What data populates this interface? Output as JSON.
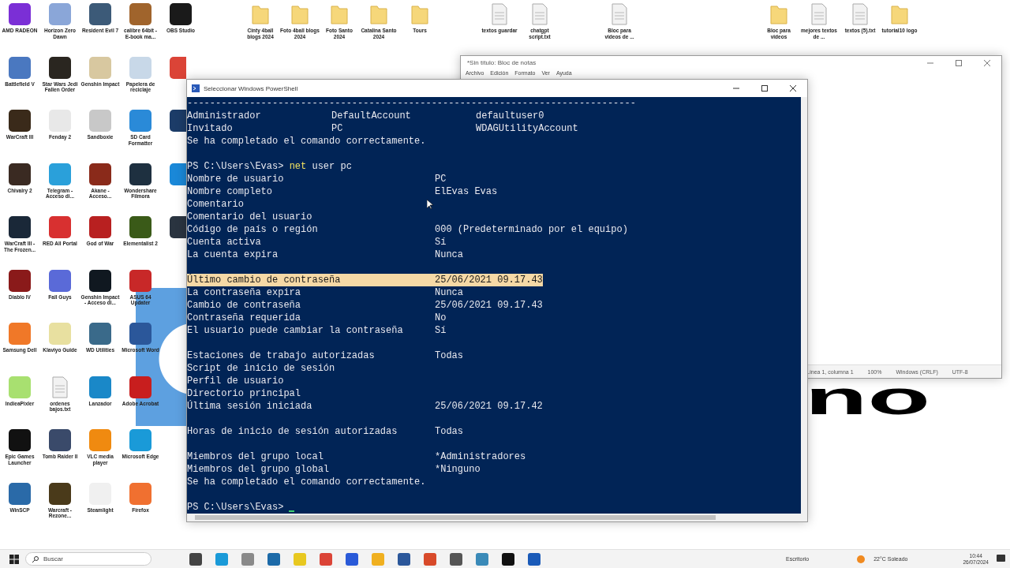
{
  "desktop": {
    "wallpaper_text": "no",
    "grid": [
      [
        {
          "label": "AMD RADEON",
          "kind": "app",
          "color": "#7b2fd6"
        },
        {
          "label": "Horizon Zero Dawn",
          "kind": "app",
          "color": "#8aa6d8"
        },
        {
          "label": "Resident Evil 7",
          "kind": "app",
          "color": "#3c5a78"
        },
        {
          "label": "calibre 64bit - E-book ma...",
          "kind": "app",
          "color": "#a0642c"
        },
        {
          "label": "OBS Studio",
          "kind": "app",
          "color": "#1a1a1a"
        }
      ],
      [
        {
          "label": "Battlefield V",
          "kind": "app",
          "color": "#4a78c0"
        },
        {
          "label": "Star Wars Jedi Fallen Order",
          "kind": "app",
          "color": "#2a2620"
        },
        {
          "label": "Genshin Impact",
          "kind": "app",
          "color": "#d8c8a0"
        },
        {
          "label": "Papelera de reciclaje",
          "kind": "app",
          "color": "#c8d8e8"
        },
        {
          "kind": "app",
          "color": "#db4437"
        }
      ],
      [
        {
          "label": "WarCraft III",
          "kind": "app",
          "color": "#3a2a1a"
        },
        {
          "label": "Fenday 2",
          "kind": "app",
          "color": "#e8e8e8"
        },
        {
          "label": "Sandboxie",
          "kind": "app",
          "color": "#c8c8c8"
        },
        {
          "label": "SD Card Formatter",
          "kind": "app",
          "color": "#2a8ad8"
        },
        {
          "kind": "app",
          "color": "#1c3c68"
        }
      ],
      [
        {
          "label": "Chivalry 2",
          "kind": "app",
          "color": "#3a2a22"
        },
        {
          "label": "Telegram - Acceso di...",
          "kind": "app",
          "color": "#2aa0da"
        },
        {
          "label": "Akane - Acceso...",
          "kind": "app",
          "color": "#8a2a1a"
        },
        {
          "label": "Wondershare Filmora",
          "kind": "app",
          "color": "#1e3040"
        },
        {
          "kind": "app",
          "color": "#1a88d8"
        }
      ],
      [
        {
          "label": "WarCraft III - The Frozen...",
          "kind": "app",
          "color": "#1a2838"
        },
        {
          "label": "RED All Portal",
          "kind": "app",
          "color": "#d83030"
        },
        {
          "label": "God of War",
          "kind": "app",
          "color": "#b82020"
        },
        {
          "label": "Elementalist 2",
          "kind": "app",
          "color": "#3a5a18"
        },
        {
          "kind": "app",
          "color": "#2a3440"
        }
      ],
      [
        {
          "label": "Diablo IV",
          "kind": "app",
          "color": "#8a1a1a"
        },
        {
          "label": "Fall Guys",
          "kind": "app",
          "color": "#5a6ad8"
        },
        {
          "label": "Genshin Impact - Acceso di...",
          "kind": "app",
          "color": "#101820"
        },
        {
          "label": "ASUS 64 Updater",
          "kind": "app",
          "color": "#c82828"
        }
      ],
      [
        {
          "label": "Samsung Dell",
          "kind": "app",
          "color": "#f07828"
        },
        {
          "label": "Klaviyo Guide",
          "kind": "app",
          "color": "#e8e0a0"
        },
        {
          "label": "WD Utilities",
          "kind": "app",
          "color": "#3a6a8a"
        },
        {
          "label": "Microsoft Word",
          "kind": "app",
          "color": "#2b579a"
        }
      ],
      [
        {
          "label": "IndieaPixler",
          "kind": "app",
          "color": "#a8e070"
        },
        {
          "label": "ordenes bajos.txt",
          "kind": "file"
        },
        {
          "label": "Lanzador",
          "kind": "app",
          "color": "#1a88c8"
        },
        {
          "label": "Adobe Acrobat",
          "kind": "app",
          "color": "#c81e1e"
        }
      ],
      [
        {
          "label": "Epic Games Launcher",
          "kind": "app",
          "color": "#111111"
        },
        {
          "label": "Tomb Raider II",
          "kind": "app",
          "color": "#3a4a6a"
        },
        {
          "label": "VLC media player",
          "kind": "app",
          "color": "#f08a10"
        },
        {
          "label": "Microsoft Edge",
          "kind": "app",
          "color": "#1a9ad8"
        }
      ],
      [
        {
          "label": "WinSCP",
          "kind": "app",
          "color": "#2a6aa8"
        },
        {
          "label": "Warcraft - Rezone...",
          "kind": "app",
          "color": "#4a3a1a"
        },
        {
          "label": "Steamlight",
          "kind": "app",
          "color": "#f0f0f0"
        },
        {
          "label": "Firefox",
          "kind": "app",
          "color": "#f07030"
        }
      ]
    ],
    "top_row": [
      {
        "label": "Cinty 4ball blogs 2024",
        "kind": "folder"
      },
      {
        "label": "Foto 4ball blogs 2024",
        "kind": "folder"
      },
      {
        "label": "Foto Santo 2024",
        "kind": "folder"
      },
      {
        "label": "Catalina Santo 2024",
        "kind": "folder"
      },
      {
        "label": "Tours",
        "kind": "folder"
      },
      {
        "label": "textos guardar",
        "kind": "file"
      },
      {
        "label": "chatgpt script.txt",
        "kind": "file"
      },
      {
        "label": "Bloc para videos de ...",
        "kind": "file"
      },
      {
        "label": "Bloc para videos",
        "kind": "folder"
      },
      {
        "label": "mejores textos de ...",
        "kind": "file"
      },
      {
        "label": "textos (5).txt",
        "kind": "file"
      },
      {
        "label": "tutorial10 logo",
        "kind": "folder"
      }
    ]
  },
  "notepad": {
    "title": "*Sin título: Bloc de notas",
    "menu": [
      "Archivo",
      "Edición",
      "Formato",
      "Ver",
      "Ayuda"
    ],
    "status": [
      "Línea 1, columna 1",
      "100%",
      "Windows (CRLF)",
      "UTF-8"
    ]
  },
  "terminal": {
    "title": "Seleccionar Windows PowerShell",
    "lines": [
      {
        "kind": "text",
        "text": "-------------------------------------------------------------------------------"
      },
      {
        "kind": "triple",
        "cells": [
          "Administrador",
          "DefaultAccount",
          "defaultuser0"
        ]
      },
      {
        "kind": "triple",
        "cells": [
          "Invitado",
          "PC",
          "WDAGUtilityAccount"
        ]
      },
      {
        "kind": "text",
        "text": "Se ha completado el comando correctamente."
      },
      {
        "kind": "blank"
      },
      {
        "kind": "prompt",
        "prompt": "PS C:\\Users\\Evas>",
        "command": "net",
        "args": "user pc"
      },
      {
        "kind": "pair",
        "label": "Nombre de usuario",
        "value": "PC",
        "selected": false
      },
      {
        "kind": "pair",
        "label": "Nombre completo",
        "value": "ElEvas Evas",
        "selected": false
      },
      {
        "kind": "pair",
        "label": "Comentario",
        "selected": false
      },
      {
        "kind": "pair",
        "label": "Comentario del usuario",
        "selected": false
      },
      {
        "kind": "pair",
        "label": "Código de país o región",
        "value": "000 (Predeterminado por el equipo)",
        "selected": false
      },
      {
        "kind": "pair",
        "label": "Cuenta activa",
        "value": "Sí",
        "selected": false
      },
      {
        "kind": "pair",
        "label": "La cuenta expira",
        "value": "Nunca",
        "selected": false
      },
      {
        "kind": "blank"
      },
      {
        "kind": "pair",
        "label": "Último cambio de contraseña",
        "value": "25/06/2021 09.17.43",
        "selected": true
      },
      {
        "kind": "pair",
        "label": "La contraseña expira",
        "value": "Nunca",
        "selected": false
      },
      {
        "kind": "pair",
        "label": "Cambio de contraseña",
        "value": "25/06/2021 09.17.43",
        "selected": false
      },
      {
        "kind": "pair",
        "label": "Contraseña requerida",
        "value": "No",
        "selected": false
      },
      {
        "kind": "pair",
        "label": "El usuario puede cambiar la contraseña",
        "value": "Sí",
        "selected": false
      },
      {
        "kind": "blank"
      },
      {
        "kind": "pair",
        "label": "Estaciones de trabajo autorizadas",
        "value": "Todas",
        "selected": false
      },
      {
        "kind": "pair",
        "label": "Script de inicio de sesión",
        "selected": false
      },
      {
        "kind": "pair",
        "label": "Perfil de usuario",
        "selected": false
      },
      {
        "kind": "pair",
        "label": "Directorio principal",
        "selected": false
      },
      {
        "kind": "pair",
        "label": "Última sesión iniciada",
        "value": "25/06/2021 09.17.42",
        "selected": false
      },
      {
        "kind": "blank"
      },
      {
        "kind": "pair",
        "label": "Horas de inicio de sesión autorizadas",
        "value": "Todas",
        "selected": false
      },
      {
        "kind": "blank"
      },
      {
        "kind": "pair",
        "label": "Miembros del grupo local",
        "value": "*Administradores",
        "selected": false
      },
      {
        "kind": "pair",
        "label": "Miembros del grupo global",
        "value": "*Ninguno",
        "selected": false
      },
      {
        "kind": "text",
        "text": "Se ha completado el comando correctamente."
      },
      {
        "kind": "blank"
      },
      {
        "kind": "prompt",
        "prompt": "PS C:\\Users\\Evas>",
        "cursor": true
      }
    ]
  },
  "taskbar": {
    "search": {
      "placeholder": "Buscar"
    },
    "apps": [
      {
        "color": "#444444"
      },
      {
        "color": "#1a9ad8"
      },
      {
        "color": "#8a8a8a"
      },
      {
        "color": "#1c6aa8"
      },
      {
        "color": "#e8c820"
      },
      {
        "color": "#db4437"
      },
      {
        "color": "#2a5ad8"
      },
      {
        "color": "#f0b020"
      },
      {
        "color": "#2b579a"
      },
      {
        "color": "#d84a2a"
      },
      {
        "color": "#555555"
      },
      {
        "color": "#3a8ab8"
      },
      {
        "color": "#111111"
      },
      {
        "color": "#1a5ab8"
      }
    ],
    "desktop_label": "Escritorio",
    "weather": "22°C  Soleado",
    "time": "10:44",
    "date": "26/07/2024"
  }
}
